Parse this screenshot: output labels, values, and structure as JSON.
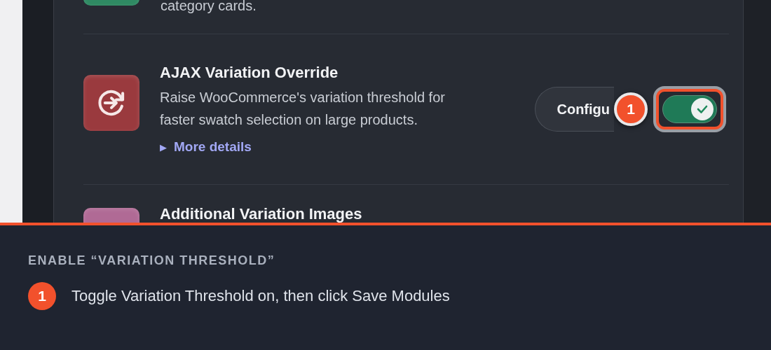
{
  "modules": [
    {
      "kind": "partial",
      "description": "category cards.",
      "color": "#2f8a63"
    },
    {
      "kind": "full",
      "title": "AJAX Variation Override",
      "description": "Raise WooCommerce's variation threshold for faster swatch selection on large products.",
      "details_marker": "▶",
      "details_link": "More details",
      "configure_button": "Configu",
      "step_badge": "1",
      "toggle": {
        "on": true,
        "highlighted": true
      },
      "color": "#9a3a3e"
    },
    {
      "kind": "cut",
      "title": "Additional Variation Images",
      "color": "#b06a95"
    }
  ],
  "instruction": {
    "heading": "ENABLE “VARIATION THRESHOLD”",
    "steps": [
      {
        "number": "1",
        "text": "Toggle Variation Threshold on, then click Save Modules"
      }
    ]
  }
}
